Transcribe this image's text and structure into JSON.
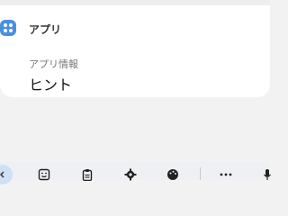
{
  "card": {
    "section_title": "アプリ",
    "info_label": "アプリ情報",
    "info_value": "ヒント"
  },
  "toolbar": {
    "icons": [
      "back-icon",
      "emoji-icon",
      "clipboard-icon",
      "settings-icon",
      "theme-icon",
      "more-icon",
      "mic-icon"
    ]
  },
  "colors": {
    "accent": "#4a90e2",
    "background": "#f2f2f2",
    "card": "#ffffff"
  }
}
